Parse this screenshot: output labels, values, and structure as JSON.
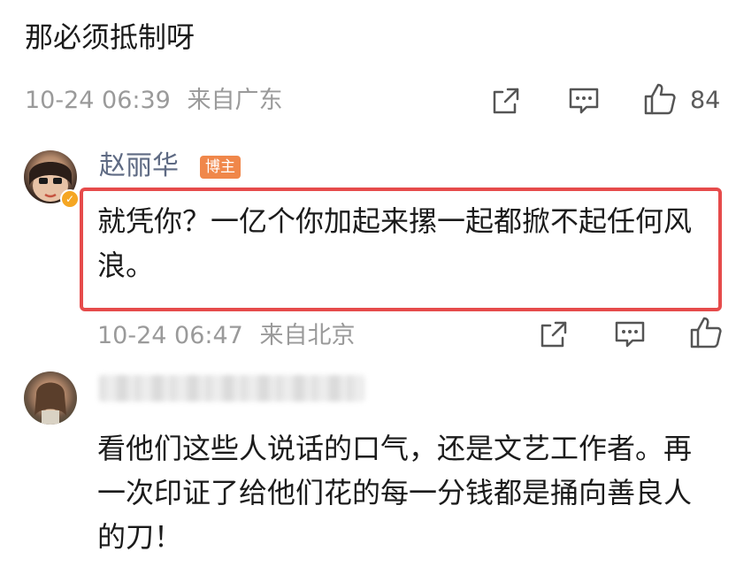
{
  "top_comment": {
    "text": "那必须抵制呀",
    "timestamp": "10-24 06:39",
    "location": "来自广东",
    "like_count": "84"
  },
  "reply": {
    "author": "赵丽华",
    "badge": "博主",
    "text": "就凭你？一亿个你加起来摞一起都掀不起任何风浪。",
    "timestamp": "10-24 06:47",
    "location": "来自北京",
    "highlight_color": "#e64b4b"
  },
  "comment_2": {
    "author": "",
    "text": "看他们这些人说话的口气，还是文艺工作者。再一次印证了给他们花的每一分钱都是捅向善良人的刀！"
  },
  "icons": {
    "share": "share-icon",
    "comment": "comment-icon",
    "like": "thumbs-up-icon"
  },
  "colors": {
    "username": "#5e6a83",
    "meta": "#9a9a9a",
    "badge": "#f0874a"
  }
}
